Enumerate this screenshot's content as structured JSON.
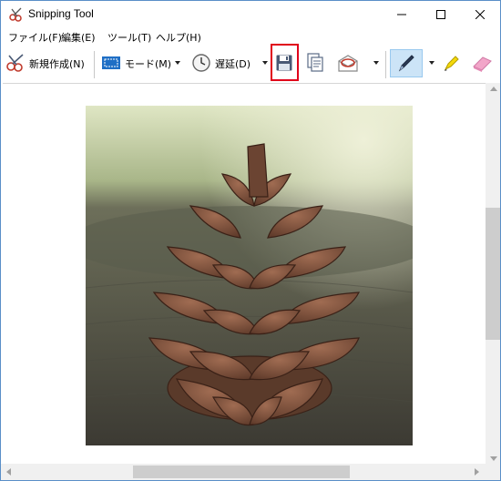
{
  "window": {
    "title": "Snipping Tool"
  },
  "menu": {
    "file": "ファイル(F)",
    "edit": "編集(E)",
    "tools": "ツール(T)",
    "help": "ヘルプ(H)"
  },
  "toolbar": {
    "new_label": "新規作成(N)",
    "mode_label": "モード(M)",
    "delay_label": "遅延(D)"
  },
  "colors": {
    "highlight": "#e0001b",
    "selected_tool": "#cce4f7"
  },
  "icons": [
    "snipping-tool-icon",
    "new-snip-icon",
    "mode-icon",
    "delay-clock-icon",
    "save-icon",
    "copy-icon",
    "send-email-icon",
    "pen-icon",
    "highlighter-icon",
    "eraser-icon"
  ]
}
